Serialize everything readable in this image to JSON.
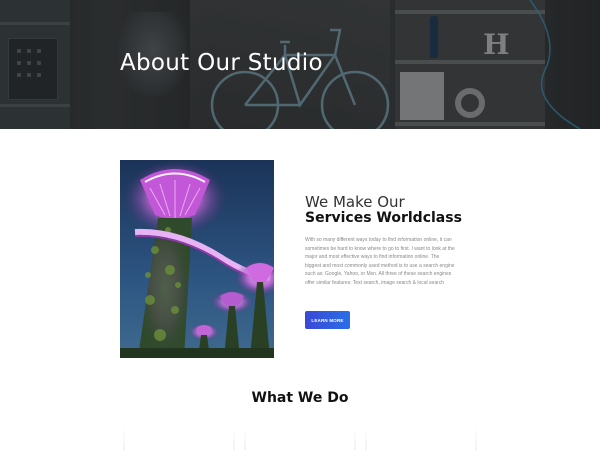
{
  "hero": {
    "title": "About Our Studio",
    "background": "#2f3234"
  },
  "about": {
    "heading_light": "We Make Our",
    "heading_bold": "Services Worldclass",
    "body": "With so many different ways today to find information online, it can sometimes be hard to know where to go to first. I want to look at the major and most effective ways to find information online. The biggest and most commonly used method is to use a search engine such as: Google, Yahoo, or Msn. All three of these search engines offer similar features: Text search, image search & local search",
    "cta_label": "LEARN MORE",
    "cta_color": "#2f5fe3"
  },
  "section2": {
    "title": "What We Do"
  },
  "colors": {
    "background": "#ffffff",
    "heading": "#111111",
    "body_text": "#888888"
  }
}
